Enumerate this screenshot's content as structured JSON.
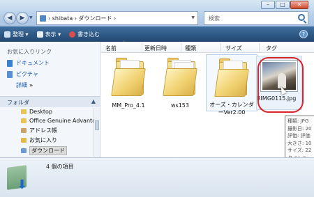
{
  "address": {
    "path": "› shibata › ダウンロード ›"
  },
  "search": {
    "placeholder": "検索"
  },
  "toolbar": {
    "organize": "整理 ▾",
    "views": "表示 ▾",
    "burn": "書き込む"
  },
  "nav": {
    "favorites_heading": "お気に入りリンク",
    "favorites": [
      "ドキュメント",
      "ピクチャ"
    ],
    "more_label": "詳細",
    "more_glyph": "»",
    "folders_label": "フォルダ",
    "folders_chevron": "▲",
    "tree": [
      "Desktop",
      "Office Genuine Advantag",
      "アドレス帳",
      "お気に入り",
      "ダウンロード"
    ]
  },
  "columns": [
    "名前",
    "更新日時",
    "種類",
    "サイズ",
    "タグ"
  ],
  "items": [
    {
      "label": "MM_Pro_4.1",
      "type": "folder"
    },
    {
      "label": "ws153",
      "type": "folder"
    },
    {
      "label_line1": "オーズ・カレンダ",
      "label_line2": "ーVer2.00",
      "type": "folder"
    },
    {
      "label": "RIMG0115.jpg",
      "type": "image"
    }
  ],
  "tooltip": {
    "lines": [
      "種類: JPG",
      "撮影日: 20",
      "評価: 評価",
      "大きさ: 10",
      "サイズ: 22",
      "タイトル:"
    ]
  },
  "details": {
    "count": "4 個の項目"
  },
  "colors": {
    "toolbar": "#2c5581",
    "highlight_circle": "#d9232a",
    "link": "#1c5db3"
  }
}
